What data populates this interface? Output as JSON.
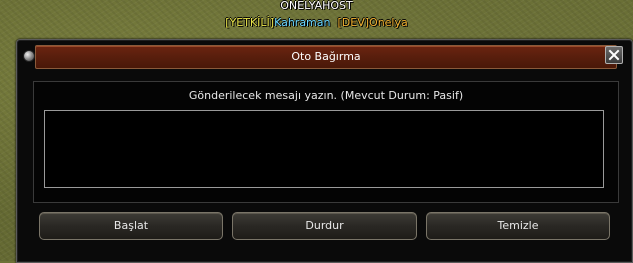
{
  "nameplate": {
    "title": "ONELYAHOST",
    "tag1": "[YETKİLİ]",
    "name1": "Kahraman",
    "tag2": "[DEV]",
    "name2": "Onelya"
  },
  "window": {
    "title": "Oto Bağırma",
    "close_icon": "close-icon",
    "pin_icon": "pin-icon"
  },
  "panel": {
    "prompt": "Gönderilecek mesajı yazın. (Mevcut Durum: Pasif)",
    "message_value": ""
  },
  "buttons": {
    "start": "Başlat",
    "stop": "Durdur",
    "clear": "Temizle"
  },
  "colors": {
    "title_bar": "#5a1f0d",
    "tag_yellow": "#e8e34a",
    "name_cyan": "#6ad8ff",
    "tag_orange": "#f0b030"
  }
}
